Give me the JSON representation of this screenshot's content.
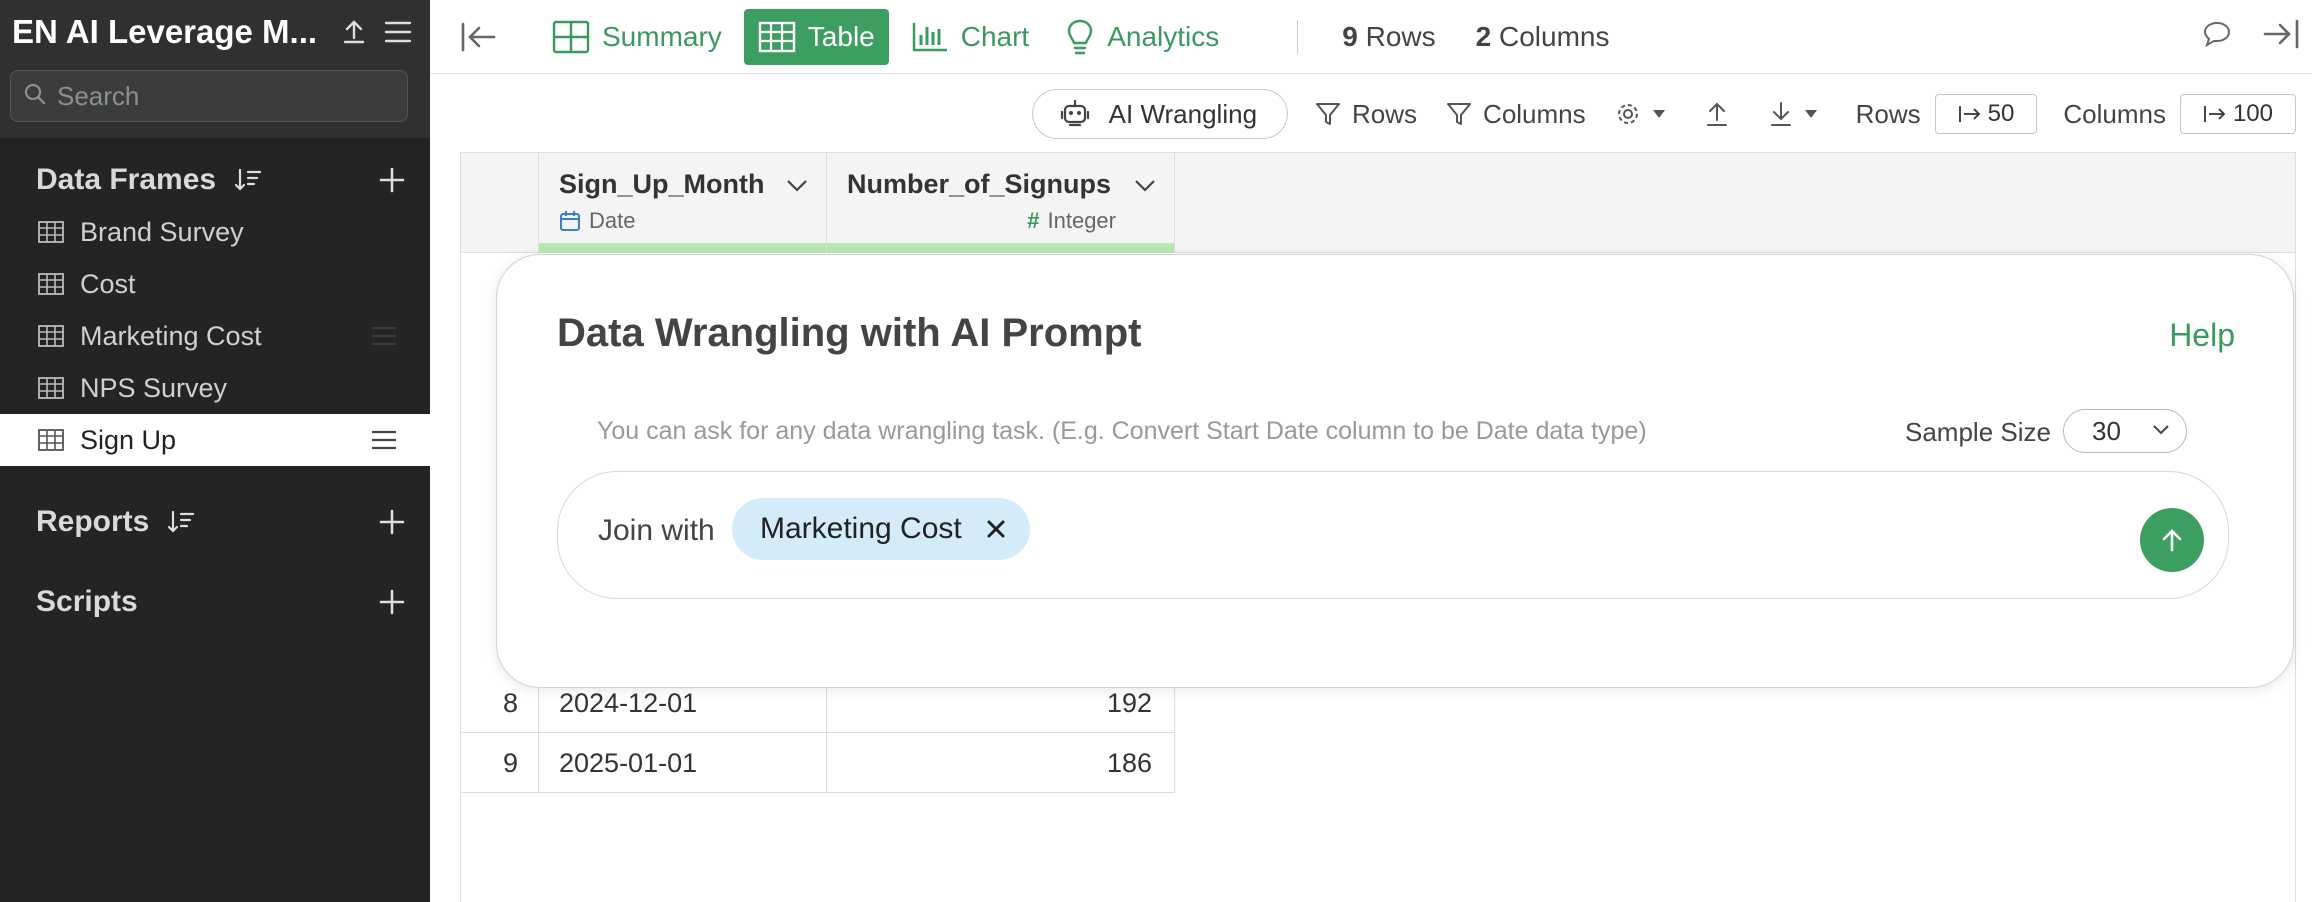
{
  "sidebar": {
    "title": "EN AI Leverage M...",
    "search_placeholder": "Search",
    "sections": {
      "data_frames": "Data Frames",
      "reports": "Reports",
      "scripts": "Scripts"
    },
    "items": [
      {
        "label": "Brand Survey"
      },
      {
        "label": "Cost"
      },
      {
        "label": "Marketing Cost"
      },
      {
        "label": "NPS Survey"
      },
      {
        "label": "Sign Up"
      }
    ],
    "active_item": "Sign Up"
  },
  "toolbar": {
    "summary": "Summary",
    "table": "Table",
    "chart": "Chart",
    "analytics": "Analytics",
    "active_tab": "Table",
    "rows_count": "9",
    "rows_label": "Rows",
    "columns_count": "2",
    "columns_label": "Columns"
  },
  "subtoolbar": {
    "ai_wrangling": "AI Wrangling",
    "rows_filter": "Rows",
    "columns_filter": "Columns",
    "rows_label": "Rows",
    "rows_limit": "50",
    "columns_label": "Columns",
    "columns_limit": "100"
  },
  "table": {
    "columns": [
      {
        "name": "Sign_Up_Month",
        "type": "Date"
      },
      {
        "name": "Number_of_Signups",
        "type": "Integer"
      }
    ],
    "rows": [
      {
        "index": "8",
        "month": "2024-12-01",
        "signups": "192"
      },
      {
        "index": "9",
        "month": "2025-01-01",
        "signups": "186"
      }
    ]
  },
  "dialog": {
    "title": "Data Wrangling with AI Prompt",
    "help": "Help",
    "hint": "You can ask for any data wrangling task. (E.g. Convert Start Date column to be Date data type)",
    "sample_size_label": "Sample Size",
    "sample_size_value": "30",
    "prompt_prefix": "Join with",
    "chip_label": "Marketing Cost"
  },
  "colors": {
    "accent": "#3c9e60",
    "sidebar_bg": "#2f3131",
    "chip_bg": "#d4ecfa",
    "column_bar": "#b9e7b4",
    "date_icon": "#3a7fd0"
  }
}
